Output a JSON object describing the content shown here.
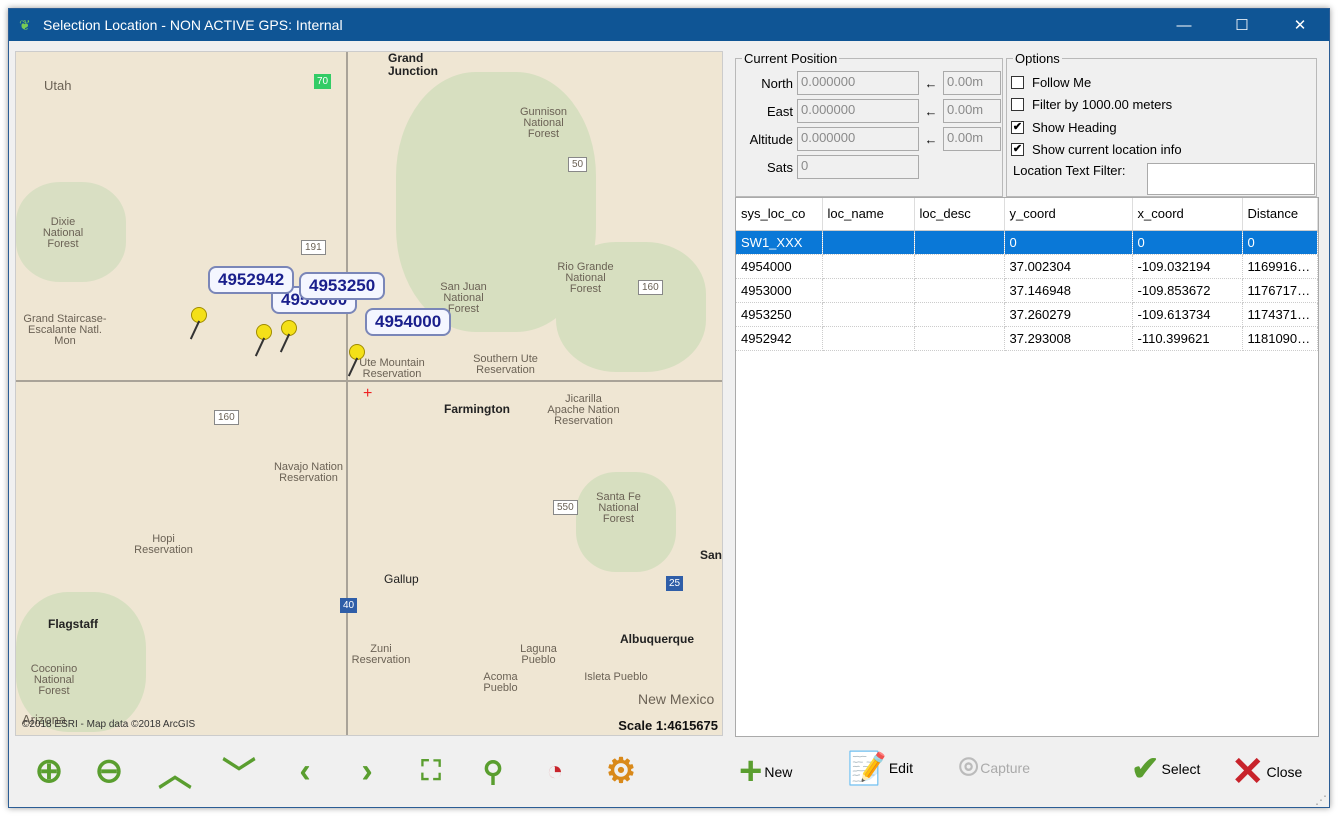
{
  "window": {
    "title": "Selection Location - NON ACTIVE GPS: Internal",
    "minimize": "—",
    "maximize": "☐",
    "close": "✕"
  },
  "map": {
    "regions": [
      "Utah",
      "Dixie National Forest",
      "Grand Staircase-Escalante Natl. Mon",
      "Gunnison National Forest",
      "Rio Grande National Forest",
      "San Juan National Forest",
      "Ute Mountain Reservation",
      "Southern Ute Reservation",
      "Jicarilla Apache Nation Reservation",
      "Navajo Nation Reservation",
      "Hopi Reservation",
      "Santa Fe National Forest",
      "Zuni Reservation",
      "Acoma Pueblo",
      "Laguna Pueblo",
      "Isleta Pueblo",
      "Coconino National Forest",
      "New Mexico",
      "Arizona"
    ],
    "cities": [
      "Grand Junction",
      "Farmington",
      "Gallup",
      "Flagstaff",
      "Albuquerque",
      "San"
    ],
    "shields": [
      "70",
      "50",
      "191",
      "160",
      "160",
      "550",
      "25",
      "40"
    ],
    "pins": [
      "4952942",
      "4953000",
      "4953250",
      "4954000"
    ],
    "attribution": "©2018 ESRI - Map data ©2018 ArcGIS",
    "scale": "Scale 1:4615675"
  },
  "position": {
    "legend": "Current Position",
    "rows": [
      {
        "label": "North",
        "value": "0.000000",
        "offset": "0.00m"
      },
      {
        "label": "East",
        "value": "0.000000",
        "offset": "0.00m"
      },
      {
        "label": "Altitude",
        "value": "0.000000",
        "offset": "0.00m"
      }
    ],
    "sats_label": "Sats",
    "sats": "0",
    "arrow": "←"
  },
  "options": {
    "legend": "Options",
    "items": [
      {
        "label": "Follow Me",
        "checked": false
      },
      {
        "label": "Filter by 1000.00 meters",
        "checked": false
      },
      {
        "label": "Show Heading",
        "checked": true
      },
      {
        "label": "Show current location info",
        "checked": true
      }
    ],
    "filter_label": "Location Text Filter:",
    "filter_value": "",
    "check": "✔"
  },
  "table": {
    "columns": [
      "sys_loc_co",
      "loc_name",
      "loc_desc",
      "y_coord",
      "x_coord",
      "Distance"
    ],
    "rows": [
      [
        "SW1_XXX",
        "",
        "",
        "0",
        "0",
        "0"
      ],
      [
        "4954000",
        "",
        "",
        "37.002304",
        "-109.032194",
        "1169916…"
      ],
      [
        "4953000",
        "",
        "",
        "37.146948",
        "-109.853672",
        "1176717…"
      ],
      [
        "4953250",
        "",
        "",
        "37.260279",
        "-109.613734",
        "1174371…"
      ],
      [
        "4952942",
        "",
        "",
        "37.293008",
        "-110.399621",
        "1181090…"
      ]
    ]
  },
  "toolbar": {
    "new": "New",
    "edit": "Edit",
    "capture": "Capture",
    "select": "Select",
    "close": "Close"
  },
  "colors": {
    "titlebar": "#0f5595",
    "selection": "#0a78d7",
    "tool_green": "#5a9e2f",
    "gear": "#d9891a",
    "close_red": "#c8232b"
  }
}
